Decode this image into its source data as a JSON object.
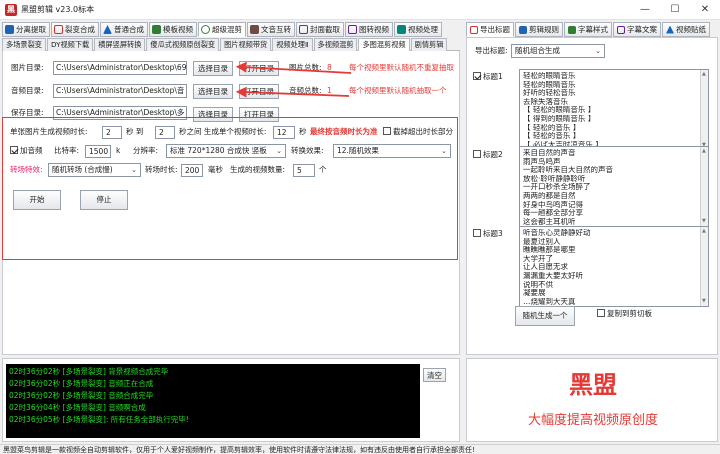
{
  "window": {
    "title": "黑盟剪辑 v23.0标本",
    "min": "—",
    "max": "☐",
    "close": "✕"
  },
  "toolbar": [
    {
      "label": "分离提取",
      "icon": "split-icon"
    },
    {
      "label": "裂变合成",
      "icon": "merge-icon"
    },
    {
      "label": "普通合成",
      "icon": "compose-icon"
    },
    {
      "label": "模板视频",
      "icon": "template-icon"
    },
    {
      "label": "超级混剪",
      "icon": "super-mix-icon"
    },
    {
      "label": "文音互转",
      "icon": "text-audio-icon"
    },
    {
      "label": "封面截取",
      "icon": "cover-icon"
    },
    {
      "label": "图转视频",
      "icon": "image-video-icon"
    },
    {
      "label": "视频处理",
      "icon": "video-process-icon"
    }
  ],
  "subtabs": [
    "多场景裂变",
    "DY视频下载",
    "横屏竖屏转换",
    "傻瓜式视频原创裂变",
    "图片视频带货",
    "视频处理Ⅱ",
    "多视频混剪",
    "多图混剪视频",
    "剧情剪辑"
  ],
  "dirs": {
    "image_label": "图片目录:",
    "image_path": "C:\\Users\\Administrator\\Desktop\\69",
    "audio_label": "音频目录:",
    "audio_path": "C:\\Users\\Administrator\\Desktop\\音",
    "save_label": "保存目录:",
    "save_path": "C:\\Users\\Administrator\\Desktop\\多",
    "choose_btn": "选择目录",
    "open_btn": "打开目录",
    "image_total_label": "图片总数:",
    "image_total": "8",
    "audio_total_label": "音频总数:",
    "audio_total": "1",
    "note_image": "每个视频里默认随机不重复抽取",
    "note_audio": "每个视频里默认随机抽取一个"
  },
  "settings": {
    "per_image_label": "单张图片生成视频时长:",
    "per_image_min": "2",
    "sec_to": "秒 到",
    "per_image_max": "2",
    "between_label": "秒之间  生成单个视频时长:",
    "video_len": "12",
    "sec": "秒",
    "hint": "最终按音频时长为准",
    "trim_label": "截掉超出时长部分",
    "add_audio_label": "加音频",
    "bitrate_label": "比特率:",
    "bitrate": "1500",
    "k": "k",
    "res_label": "分辨率:",
    "resolution": "标准 720*1280 合成快 竖板",
    "effect_label": "转换效果:",
    "effect": "12.随机效果",
    "trans_label": "转场特效:",
    "transition": "随机转场 (合成慢)",
    "trans_len_label": "转场时长:",
    "trans_len": "200",
    "ms": "毫秒",
    "count_label": "生成的视频数量:",
    "count": "5",
    "ge": "个",
    "start_btn": "开始",
    "stop_btn": "停止"
  },
  "log": {
    "lines": [
      "02时36分02秒 [多场景裂变] 背景视频合成完毕",
      "02时36分02秒 [多场景裂变] 音频正在合成",
      "02时36分02秒 [多场景裂变] 音频合成完毕",
      "02时36分04秒 [多场景裂变] 音频啊合成",
      "02时36分05秒 [多场景裂变]: 所有任务全部执行完毕!"
    ],
    "clear_btn": "清空"
  },
  "right_tabs": [
    {
      "label": "导出标题",
      "icon": "export-title-icon"
    },
    {
      "label": "剪辑规则",
      "icon": "rules-icon"
    },
    {
      "label": "字幕样式",
      "icon": "subtitle-style-icon"
    },
    {
      "label": "字幕文案",
      "icon": "subtitle-text-icon"
    },
    {
      "label": "视频贴纸",
      "icon": "sticker-icon"
    }
  ],
  "titles": {
    "export_label": "导出标题:",
    "export_mode": "随机组合生成",
    "t1_label": "标题1",
    "t1_items": [
      "轻松的眼睛音乐",
      "轻松的眼睛音乐",
      "好听的轻松音乐",
      "去除失落音乐",
      "【 轻松的眼睛音乐 】",
      "【 得到的眼睛音乐 】",
      "【 轻松的音乐 】",
      "【 轻松的音乐 】",
      "【 必ば大吉时凉音乐 】"
    ],
    "t2_label": "标题2",
    "t2_items": [
      "来自自然的声音",
      "雨声鸟鸣声",
      "一起聆听来自大自然的声音",
      "放松·聆听静静聆听",
      "一开口秒杀全场醉了",
      "两两的都是自然",
      "好身中鸟鸣声记得",
      "每一趟都全部分享",
      "这会都主耳机听"
    ],
    "t3_label": "标题3",
    "t3_items": [
      "听音乐心灵静静好动",
      "最夏过别人",
      "瞧瞧瞧那是哪里",
      "大学开了",
      "让人自愿无求",
      "漏漏重大要太好听",
      "说明不供",
      "凝要展",
      "…烧耀到大天真"
    ],
    "gen_btn": "随机生成一个",
    "copy_label": "复制到剪切板"
  },
  "brand": {
    "name": "黑盟",
    "slogan": "大幅度提高视频原创度"
  },
  "status": "黑盟菜鸟剪辑是一款视频全自动剪辑软件，仅用于个人爱好视频制作，提高剪辑效率，使用软件时请遵守法律法规，如有违反由使用者自行承担全部责任!"
}
